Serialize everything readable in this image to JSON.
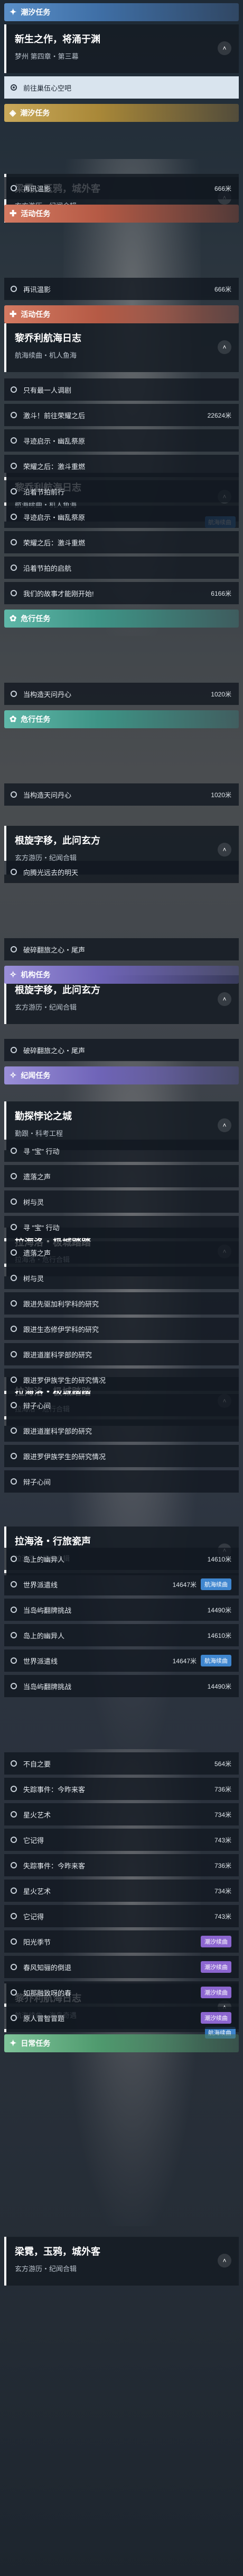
{
  "blocks": [
    {
      "type": "header",
      "color": "blue",
      "icon": "✦",
      "label": "潮汐任务",
      "icon_name": "tide-quest-icon"
    },
    {
      "type": "card",
      "title": "新生之作，将涌于渊",
      "sub": "梦州 第四章・第三幕",
      "chevron": "˄"
    },
    {
      "type": "row",
      "text": "前往巢伍心空吧",
      "active": true
    },
    {
      "type": "header",
      "color": "gold",
      "icon": "◈",
      "label": "潮汐任务",
      "icon_name": "tide-quest-icon"
    },
    {
      "type": "card",
      "title": "梁霓，玉鸦，城外客",
      "sub": "玄方游历・纪闻合辑",
      "chevron": "˄"
    },
    {
      "type": "row",
      "text": "再讯温影",
      "dist": "666米"
    },
    {
      "type": "header",
      "color": "red",
      "icon": "✚",
      "label": "活动任务",
      "icon_name": "event-quest-icon"
    },
    {
      "type": "card",
      "title": "黎乔利航海日志",
      "sub": "航海续曲・机人鱼海",
      "chevron": "˄"
    },
    {
      "type": "row",
      "text": "再讯温影",
      "dist": "666米"
    },
    {
      "type": "header",
      "color": "red",
      "icon": "✚",
      "label": "活动任务",
      "icon_name": "event-quest-icon"
    },
    {
      "type": "card",
      "title": "黎乔利航海日志",
      "sub": "航海续曲・机人鱼海",
      "chevron": "˄",
      "tag": "航海续曲"
    },
    {
      "type": "row",
      "text": "只有最一人调剧"
    },
    {
      "type": "row",
      "text": "激斗！前往荣耀之后",
      "dist": "22624米"
    },
    {
      "type": "row",
      "text": "寻迹启示・幽乱祭原"
    },
    {
      "type": "row",
      "text": "荣耀之后：激斗重燃"
    },
    {
      "type": "row",
      "text": "沿着节拍前行"
    },
    {
      "type": "row",
      "text": "寻迹启示・幽乱祭原"
    },
    {
      "type": "row",
      "text": "荣耀之后：激斗重燃"
    },
    {
      "type": "row",
      "text": "沿着节拍的启航"
    },
    {
      "type": "row",
      "text": "我们的故事才能刚开始!",
      "dist": "6166米"
    },
    {
      "type": "header",
      "color": "teal",
      "icon": "✿",
      "label": "危行任务",
      "icon_name": "journey-quest-icon"
    },
    {
      "type": "card",
      "title": "根旋字移，此问玄方",
      "sub": "玄方游历・纪闻合辑",
      "chevron": "˄"
    },
    {
      "type": "row",
      "text": "当构造天问丹心",
      "dist": "1020米"
    },
    {
      "type": "header",
      "color": "teal",
      "icon": "✿",
      "label": "危行任务",
      "icon_name": "journey-quest-icon"
    },
    {
      "type": "card",
      "title": "根旋字移，此问玄方",
      "sub": "玄方游历・纪闻合辑",
      "chevron": "˄"
    },
    {
      "type": "row",
      "text": "当构造天问丹心",
      "dist": "1020米"
    },
    {
      "type": "card",
      "title": "勤探悖论之城",
      "sub": "勤跟・科考工程",
      "chevron": "˄"
    },
    {
      "type": "row",
      "text": "向腾光远去的明天"
    },
    {
      "type": "card",
      "title": "拉海洛・极城踏踏",
      "sub": "拉海洛・危行合辑",
      "chevron": "˄"
    },
    {
      "type": "row",
      "text": "破碎翻旅之心・尾声"
    },
    {
      "type": "header",
      "color": "violet",
      "icon": "✧",
      "label": "机构任务",
      "icon_name": "org-quest-icon"
    },
    {
      "type": "card",
      "title": "拉海洛・极城踏踏",
      "sub": "拉海洛・危行合辑",
      "chevron": "˄"
    },
    {
      "type": "row",
      "text": "破碎翻旅之心・尾声"
    },
    {
      "type": "header",
      "color": "violet",
      "icon": "✧",
      "label": "纪闻任务",
      "icon_name": "chronicle-quest-icon"
    },
    {
      "type": "card",
      "title": "拉海洛・行旅瓷声",
      "sub": "拉海洛・纪闻合辑",
      "chevron": "˄"
    },
    {
      "type": "row",
      "text": "寻 \"宝\" 行动"
    },
    {
      "type": "row",
      "text": "遗落之声"
    },
    {
      "type": "row",
      "text": "树与灵"
    },
    {
      "type": "row",
      "text": "寻 \"宝\" 行动"
    },
    {
      "type": "row",
      "text": "遗落之声"
    },
    {
      "type": "row",
      "text": "树与灵"
    },
    {
      "type": "row",
      "text": "跟进先驱加利学科的研究"
    },
    {
      "type": "row",
      "text": "跟进生态修伊学科的研究"
    },
    {
      "type": "row",
      "text": "跟进道崖科学部的研究"
    },
    {
      "type": "row",
      "text": "跟进罗伊族学生的研究情况"
    },
    {
      "type": "row",
      "text": "辩子心间"
    },
    {
      "type": "row",
      "text": "跟进道崖科学部的研究"
    },
    {
      "type": "row",
      "text": "跟进罗伊族学生的研究情况"
    },
    {
      "type": "row",
      "text": "辩子心间"
    },
    {
      "type": "card",
      "title": "黎乔利航海日志",
      "sub": "航海续曲・海岛奇遇",
      "chevron": "˄",
      "tag": "航海续曲"
    },
    {
      "type": "row",
      "text": "岛上的幽异人",
      "dist": "14610米"
    },
    {
      "type": "row",
      "text": "世界派遣线",
      "dist": "14647米",
      "tag": "航海续曲"
    },
    {
      "type": "row",
      "text": "当岛屿翻牌挑战",
      "dist": "14490米"
    },
    {
      "type": "row",
      "text": "岛上的幽异人",
      "dist": "14610米"
    },
    {
      "type": "row",
      "text": "世界派遣线",
      "dist": "14647米",
      "tag": "航海续曲"
    },
    {
      "type": "row",
      "text": "当岛屿翻牌挑战",
      "dist": "14490米"
    },
    {
      "type": "card",
      "title": "梁霓，玉鸦，城外客",
      "sub": "玄方游历・纪闻合辑",
      "chevron": "˄"
    },
    {
      "type": "row",
      "text": "不自之要",
      "dist": "564米"
    },
    {
      "type": "row",
      "text": "失踪事件：今昨来客",
      "dist": "736米"
    },
    {
      "type": "row",
      "text": "星火艺术",
      "dist": "734米"
    },
    {
      "type": "row",
      "text": "它记得",
      "dist": "743米"
    },
    {
      "type": "row",
      "text": "失踪事件：今昨来客",
      "dist": "736米"
    },
    {
      "type": "row",
      "text": "星火艺术",
      "dist": "734米"
    },
    {
      "type": "row",
      "text": "它记得",
      "dist": "743米"
    },
    {
      "type": "row",
      "text": "阳光季节",
      "tag": "潮汐续曲"
    },
    {
      "type": "row",
      "text": "春风知骊的倒退",
      "tag": "潮汐续曲"
    },
    {
      "type": "row",
      "text": "如那融致呀的春",
      "tag": "潮汐续曲"
    },
    {
      "type": "row",
      "text": "原人冒智冒题",
      "tag": "潮汐续曲"
    },
    {
      "type": "header",
      "color": "green",
      "icon": "✦",
      "label": "日常任务",
      "icon_name": "daily-quest-icon"
    }
  ],
  "tag_colors": {
    "航海续曲": "#3f86cf",
    "潮汐续曲": "#8c66d0"
  }
}
